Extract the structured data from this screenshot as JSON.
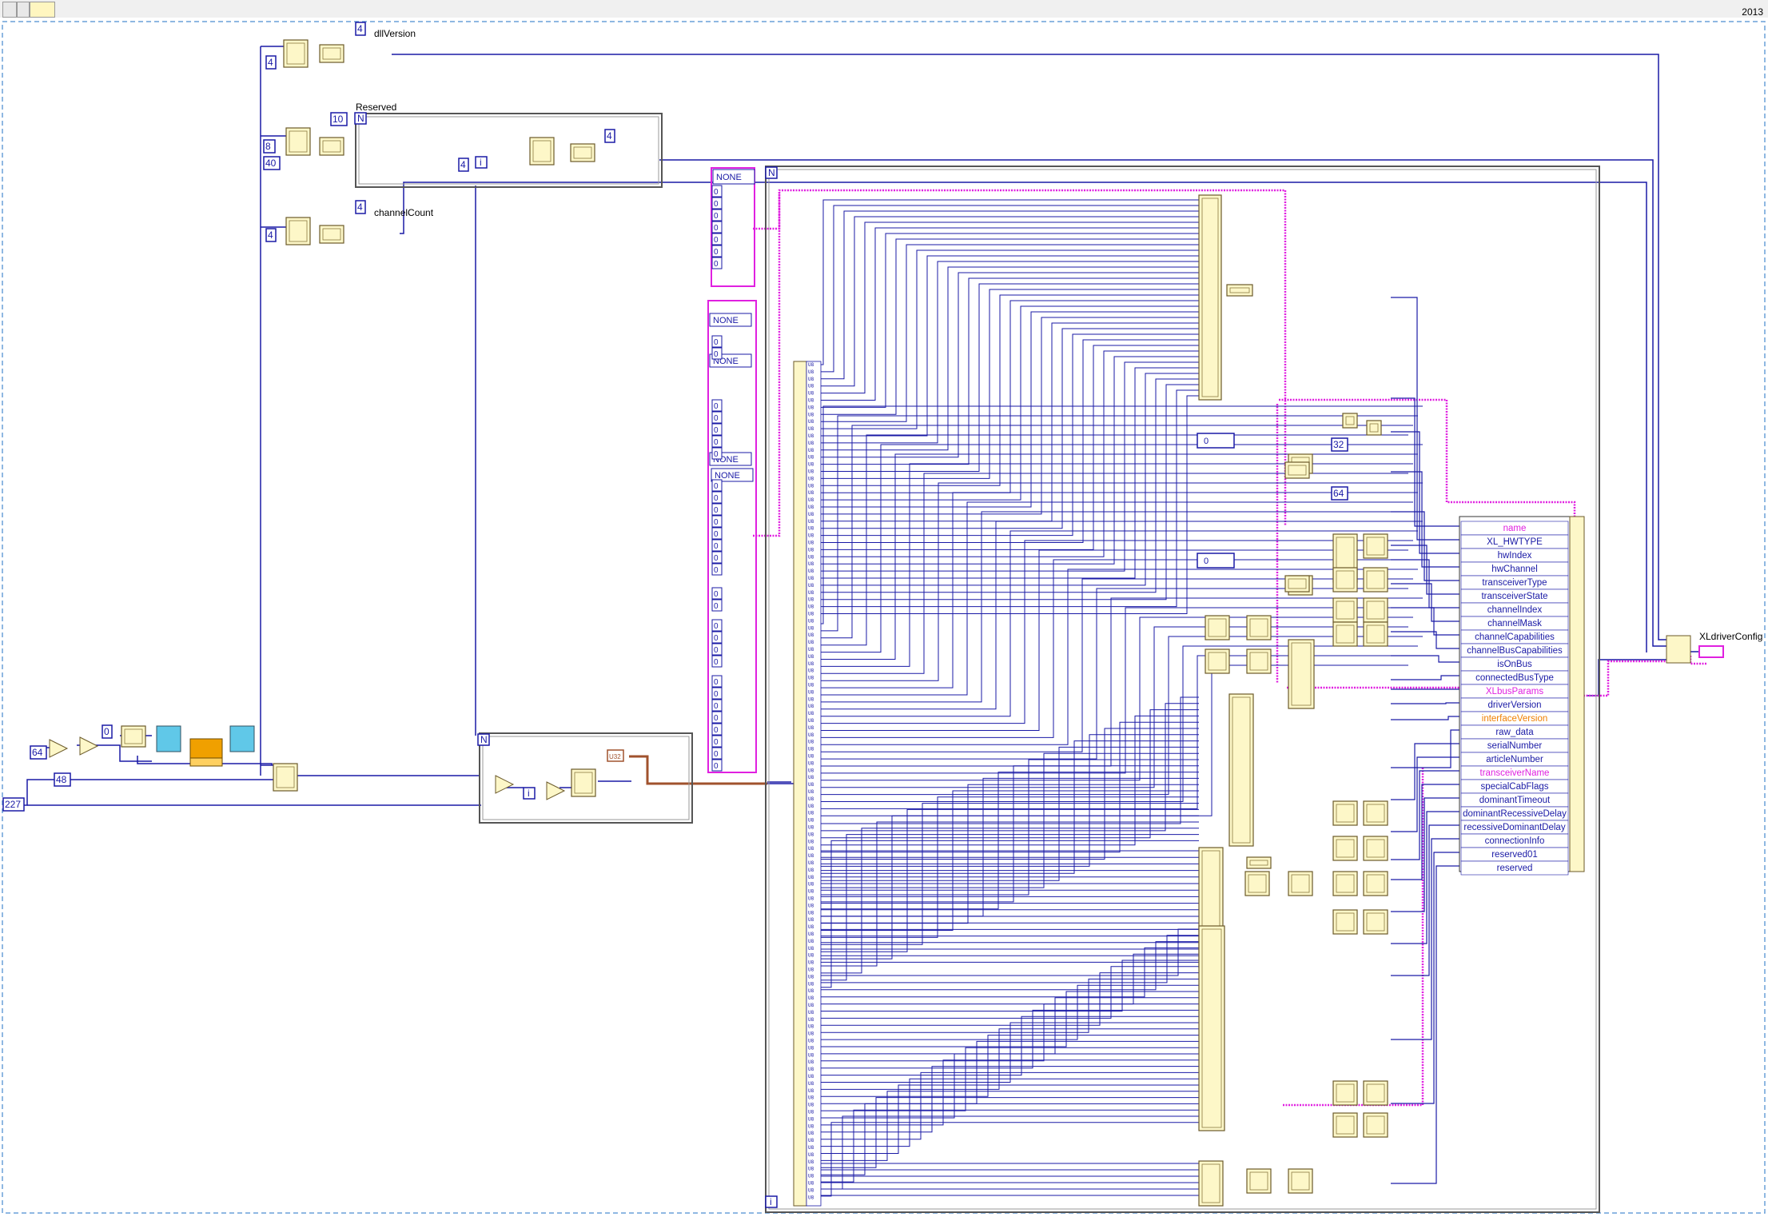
{
  "toolbar": {
    "buttons": [
      "run-continuous-icon",
      "pan-icon",
      "run-icon"
    ],
    "year": "2013"
  },
  "constants": {
    "c4_top": "4",
    "c4_a": "4",
    "c8": "8",
    "c40": "40",
    "c4_b": "4",
    "c10": "10",
    "c4_c": "4",
    "c4_d": "4",
    "c4_e": "4",
    "c64": "64",
    "c48": "48",
    "c227": "227",
    "c0": "0",
    "c32": "32",
    "c64b": "64",
    "u32": "U32"
  },
  "labels": {
    "dll_version": "dllVersion",
    "reserved": "Reserved",
    "channel_count": "channelCount",
    "xl_driver_config": "XLdriverConfig"
  },
  "loop_labels": {
    "n": "N",
    "i": "i"
  },
  "enum_none": "NONE",
  "array_zero": "0",
  "cluster_fields": [
    {
      "label": "name",
      "color": "pink"
    },
    {
      "label": "XL_HWTYPE",
      "color": "blue"
    },
    {
      "label": "hwIndex",
      "color": "blue"
    },
    {
      "label": "hwChannel",
      "color": "blue"
    },
    {
      "label": "transceiverType",
      "color": "blue"
    },
    {
      "label": "transceiverState",
      "color": "blue"
    },
    {
      "label": "channelIndex",
      "color": "blue"
    },
    {
      "label": "channelMask",
      "color": "blue"
    },
    {
      "label": "channelCapabilities",
      "color": "blue"
    },
    {
      "label": "channelBusCapabilities",
      "color": "blue"
    },
    {
      "label": "isOnBus",
      "color": "blue"
    },
    {
      "label": "connectedBusType",
      "color": "blue"
    },
    {
      "label": "XLbusParams",
      "color": "pink"
    },
    {
      "label": "driverVersion",
      "color": "blue"
    },
    {
      "label": "interfaceVersion",
      "color": "orange"
    },
    {
      "label": "raw_data",
      "color": "blue"
    },
    {
      "label": "serialNumber",
      "color": "blue"
    },
    {
      "label": "articleNumber",
      "color": "blue"
    },
    {
      "label": "transceiverName",
      "color": "pink"
    },
    {
      "label": "specialCabFlags",
      "color": "blue"
    },
    {
      "label": "dominantTimeout",
      "color": "blue"
    },
    {
      "label": "dominantRecessiveDelay",
      "color": "blue"
    },
    {
      "label": "recessiveDominantDelay",
      "color": "blue"
    },
    {
      "label": "connectionInfo",
      "color": "blue"
    },
    {
      "label": "reserved01",
      "color": "blue"
    },
    {
      "label": "reserved",
      "color": "blue"
    }
  ],
  "byte_index_label": "U8",
  "colors": {
    "wire_blue": "#1a1aa6",
    "wire_pink": "#e020e0",
    "wire_orange": "#f08000",
    "wire_brown": "#a0522d",
    "node_fill": "#fdf7c8",
    "node_border": "#6b5a2a",
    "frame_border": "#555555"
  }
}
